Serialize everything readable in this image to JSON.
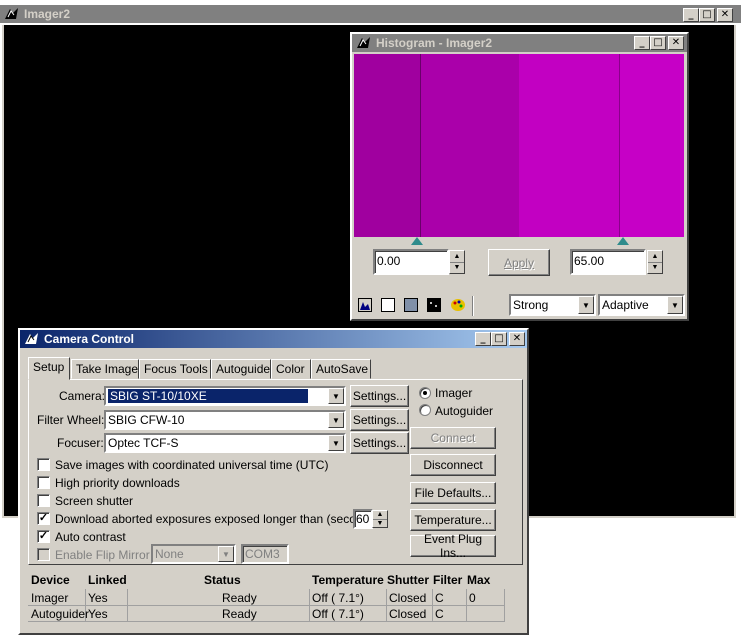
{
  "imager": {
    "title": "Imager2"
  },
  "histogram": {
    "title": "Histogram - Imager2",
    "left_value": "0.00",
    "right_value": "65.00",
    "apply_label": "Apply",
    "stretch_mode": "Strong",
    "stretch_type": "Adaptive"
  },
  "camera_control": {
    "title": "Camera Control",
    "tabs": [
      "Setup",
      "Take Image",
      "Focus Tools",
      "Autoguide",
      "Color",
      "AutoSave"
    ],
    "selected_tab": "Setup",
    "camera_label": "Camera:",
    "camera_value": "SBIG ST-10/10XE",
    "filter_wheel_label": "Filter Wheel:",
    "filter_wheel_value": "SBIG CFW-10",
    "focuser_label": "Focuser:",
    "focuser_value": "Optec TCF-S",
    "settings_label": "Settings...",
    "radio_imager": "Imager",
    "radio_autoguider": "Autoguider",
    "checkboxes": {
      "utc": "Save images with coordinated universal time (UTC)",
      "high_priority": "High priority downloads",
      "screen_shutter": "Screen shutter",
      "download_aborted": "Download aborted exposures exposed longer than (seconds):",
      "auto_contrast": "Auto contrast",
      "flip_mirror": "Enable Flip Mirror"
    },
    "download_aborted_seconds": "60",
    "flip_mirror_select": "None",
    "flip_mirror_port": "COM3",
    "buttons": {
      "connect": "Connect",
      "disconnect": "Disconnect",
      "file_defaults": "File Defaults...",
      "temperature": "Temperature...",
      "event_plugins": "Event Plug Ins..."
    },
    "table": {
      "headers": [
        "Device",
        "Linked",
        "Status",
        "Temperature",
        "Shutter",
        "Filter",
        "Max"
      ],
      "rows": [
        [
          "Imager",
          "Yes",
          "Ready",
          "Off ( 7.1°)",
          "Closed",
          "C",
          "0"
        ],
        [
          "Autoguider",
          "Yes",
          "Ready",
          "Off ( 7.1°)",
          "Closed",
          "C",
          ""
        ]
      ]
    }
  },
  "colors": {
    "histogram_left": "#a0009f",
    "histogram_right": "#c000c0",
    "histogram_fill": "#b400b4",
    "marker": "#2e8b8b"
  }
}
